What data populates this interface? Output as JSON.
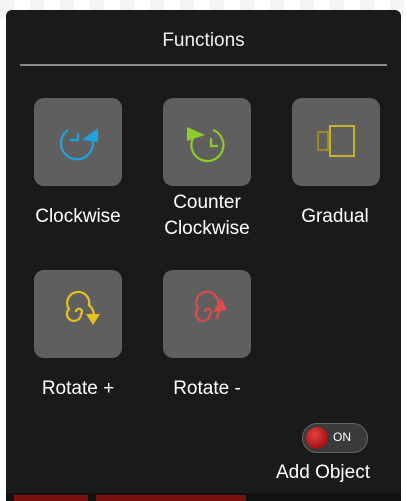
{
  "panel": {
    "title": "Functions"
  },
  "functions": [
    {
      "label": "Clockwise",
      "icon": "clockwise-icon",
      "color": "#1fa3e0"
    },
    {
      "label": "Counter\nClockwise",
      "icon": "counter-clockwise-icon",
      "color": "#8fcc2a"
    },
    {
      "label": "Gradual",
      "icon": "gradual-icon",
      "color": "#c9b22b"
    },
    {
      "label": "Rotate +",
      "icon": "spiral-rotate-plus-icon",
      "color": "#e6c21e"
    },
    {
      "label": "Rotate -",
      "icon": "spiral-rotate-minus-icon",
      "color": "#e04a4a"
    }
  ],
  "add_object": {
    "state": "ON",
    "label": "Add Object"
  }
}
